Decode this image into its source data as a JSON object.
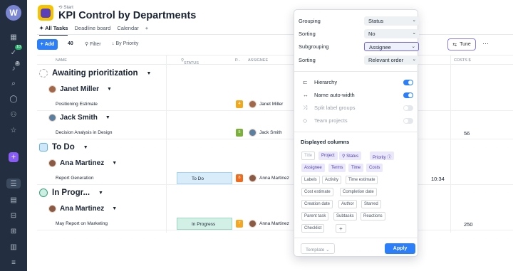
{
  "rail": {
    "logo": "W",
    "icons": [
      "grid-icon",
      "inbox-icon",
      "bell-icon",
      "search-icon",
      "chat-icon",
      "users-icon",
      "star-icon"
    ],
    "badges": {
      "inbox": "10",
      "bell": "2"
    }
  },
  "header": {
    "breadcrumb": "Start",
    "title": "KPI Control by Departments"
  },
  "tabs": [
    "All Tasks",
    "Deadline board",
    "Calendar",
    "+"
  ],
  "toolbar": {
    "add_label": "Add",
    "count": "40",
    "filter_label": "Filter",
    "sort_label": "By Priority",
    "tune_label": "Tune",
    "more": "···"
  },
  "columns": [
    "NAME",
    "STATUS",
    "P...",
    "ASSIGNEE",
    "COSTS $"
  ],
  "groups": [
    {
      "label": "Awaiting prioritization",
      "color": "#d7dbe0"
    },
    {
      "label": "To Do",
      "color": "#9ad0f2"
    },
    {
      "label": "In Progr...",
      "color": "#7fcfb3"
    }
  ],
  "persons": [
    "Janet Miller",
    "Jack Smith",
    "Ana Martinez",
    "Ana Martinez"
  ],
  "rows": [
    {
      "name": "Positioning Estimate",
      "status": "",
      "prio": "4",
      "prio_color": "#f2a81d",
      "assignee": "Janet Miller",
      "extra": "",
      "cost": ""
    },
    {
      "name": "Decision Analysis in Design",
      "status": "",
      "prio": "5",
      "prio_color": "#7bb03b",
      "assignee": "Jack Smith",
      "extra": "",
      "cost": "56"
    },
    {
      "name": "Report Generation",
      "status": "To Do",
      "prio": "8",
      "prio_color": "#f26a1b",
      "assignee": "Anna Martinez",
      "extra": "10:34",
      "cost": ""
    },
    {
      "name": "May Report on Marketing",
      "status": "In Progress",
      "prio": "7",
      "prio_color": "#f5a623",
      "assignee": "Anna Martinez",
      "extra": "",
      "cost": "250"
    }
  ],
  "tune_popup": {
    "grouping_label": "Grouping",
    "grouping_value": "Status",
    "sorting_label": "Sorting",
    "sorting_value": "No",
    "subgrouping_label": "Subgrouping",
    "subgrouping_value": "Assignee",
    "sorting2_label": "Sorting",
    "sorting2_value": "Relevant order",
    "toggles": [
      {
        "label": "Hierarchy",
        "on": true
      },
      {
        "label": "Name auto-width",
        "on": true
      },
      {
        "label": "Split label groups",
        "on": false
      },
      {
        "label": "Team projects",
        "on": false
      }
    ],
    "displayed_columns_title": "Displayed columns",
    "chips": [
      "Title",
      "Project",
      "Status",
      "Priority",
      "Assignee",
      "Terms",
      "Time",
      "Costs",
      "Labels",
      "Activity",
      "Time estimate",
      "Cost estimate",
      "Completion date",
      "Creation date",
      "Author",
      "Starred",
      "Parent task",
      "Subtasks",
      "Reactions",
      "Checklist",
      "+"
    ],
    "template_label": "Template",
    "apply_label": "Apply"
  }
}
